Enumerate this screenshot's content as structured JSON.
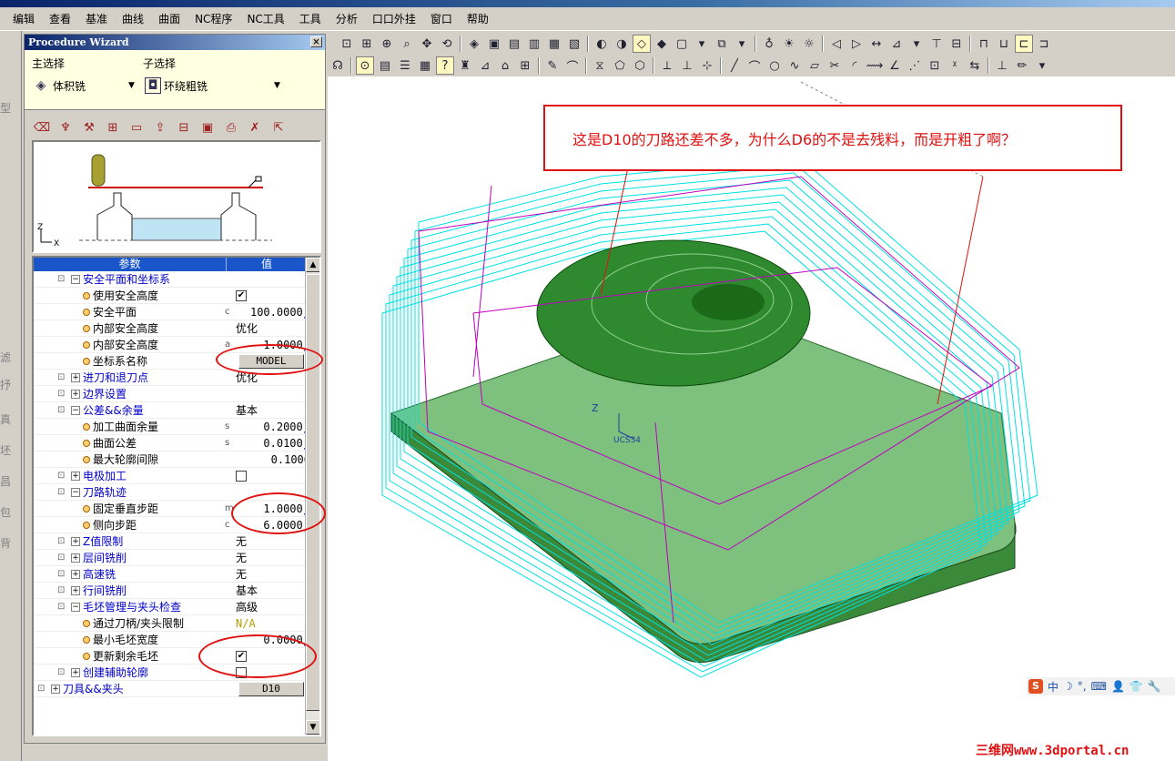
{
  "menubar": {
    "items": [
      "编辑",
      "查看",
      "基准",
      "曲线",
      "曲面",
      "NC程序",
      "NC工具",
      "工具",
      "分析",
      "口口外挂",
      "窗口",
      "帮助"
    ]
  },
  "wizard": {
    "title": "Procedure Wizard",
    "close_label": "×",
    "main_select_label": "主选择",
    "main_select_value": "体积铣",
    "sub_select_label": "子选择",
    "sub_select_value": "环绕粗铣",
    "grid": {
      "header_param": "参数",
      "header_value": "值",
      "rows": [
        {
          "kind": "group",
          "expanded": true,
          "label": "安全平面和坐标系",
          "flag": "",
          "value": ""
        },
        {
          "kind": "leaf",
          "label": "使用安全高度",
          "flag": "",
          "value": "",
          "check": "✔"
        },
        {
          "kind": "leaf",
          "label": "安全平面",
          "flag": "c",
          "value": "100.0000",
          "f": "ƒ"
        },
        {
          "kind": "leaf",
          "label": "内部安全高度",
          "flag": "",
          "value": "优化"
        },
        {
          "kind": "leaf",
          "label": "内部安全高度",
          "flag": "a",
          "value": "1.0000",
          "f": "ƒ"
        },
        {
          "kind": "leaf",
          "label": "坐标系名称",
          "flag": "",
          "button": "MODEL"
        },
        {
          "kind": "group",
          "expanded": false,
          "label": "进刀和退刀点",
          "flag": "",
          "value": "优化"
        },
        {
          "kind": "group",
          "expanded": false,
          "label": "边界设置",
          "flag": "",
          "value": ""
        },
        {
          "kind": "group",
          "expanded": true,
          "label": "公差&&余量",
          "flag": "",
          "value": "基本"
        },
        {
          "kind": "leaf",
          "label": "加工曲面余量",
          "flag": "s",
          "value": "0.2000",
          "f": "ƒ"
        },
        {
          "kind": "leaf",
          "label": "曲面公差",
          "flag": "s",
          "value": "0.0100",
          "f": "ƒ"
        },
        {
          "kind": "leaf",
          "label": "最大轮廓间隙",
          "flag": "",
          "value": "0.1000"
        },
        {
          "kind": "group",
          "expanded": false,
          "label": "电极加工",
          "flag": "",
          "check": ""
        },
        {
          "kind": "group",
          "expanded": true,
          "label": "刀路轨迹",
          "flag": "",
          "value": ""
        },
        {
          "kind": "leaf",
          "label": "固定垂直步距",
          "flag": "m",
          "value": "1.0000",
          "f": "ƒ"
        },
        {
          "kind": "leaf",
          "label": "侧向步距",
          "flag": "c",
          "value": "6.0000",
          "f": "ƒ"
        },
        {
          "kind": "group",
          "expanded": false,
          "label": "Z值限制",
          "flag": "",
          "value": "无"
        },
        {
          "kind": "group",
          "expanded": false,
          "label": "层间铣削",
          "flag": "",
          "value": "无"
        },
        {
          "kind": "group",
          "expanded": false,
          "label": "高速铣",
          "flag": "",
          "value": "无"
        },
        {
          "kind": "group",
          "expanded": false,
          "label": "行间铣削",
          "flag": "",
          "value": "基本"
        },
        {
          "kind": "group",
          "expanded": true,
          "label": "毛坯管理与夹头检查",
          "flag": "",
          "value": "高级"
        },
        {
          "kind": "leaf",
          "label": "通过刀柄/夹头限制",
          "flag": "",
          "value": "N/A"
        },
        {
          "kind": "leaf",
          "label": "最小毛坯宽度",
          "flag": "",
          "value": "0.0000",
          "f": "ƒ"
        },
        {
          "kind": "leaf",
          "label": "更新剩余毛坯",
          "flag": "",
          "check": "✔"
        },
        {
          "kind": "group",
          "expanded": false,
          "label": "创建辅助轮廓",
          "flag": "",
          "check": ""
        },
        {
          "kind": "group",
          "expanded": false,
          "label": "刀具&&夹头",
          "flag": "",
          "button": "D10",
          "top": true
        }
      ]
    },
    "preview_axis_z": "Z",
    "preview_axis_x": "X"
  },
  "annotation": {
    "text": "这是D10的刀路还差不多，为什么D6的不是去残料，而是开粗了啊？"
  },
  "viewport": {
    "ucs_label": "UCS34",
    "axis_z": "Z"
  },
  "ime_bar": {
    "logo": "S",
    "items": [
      "中",
      "☽",
      "°,",
      "⌨",
      "👤",
      "👕",
      "🔧"
    ]
  },
  "watermark": "三维网www.3dportal.cn",
  "left_strip_labels": [
    "型",
    "滤",
    "抒",
    "真",
    "坯",
    "昌",
    "包",
    "背"
  ],
  "colors": {
    "annotation_red": "#e01010",
    "toolpath_cyan": "#00e0e0",
    "toolpath_magenta": "#c000c0",
    "part_green": "#5aa05a",
    "grid_header_blue": "#1a56c9"
  }
}
